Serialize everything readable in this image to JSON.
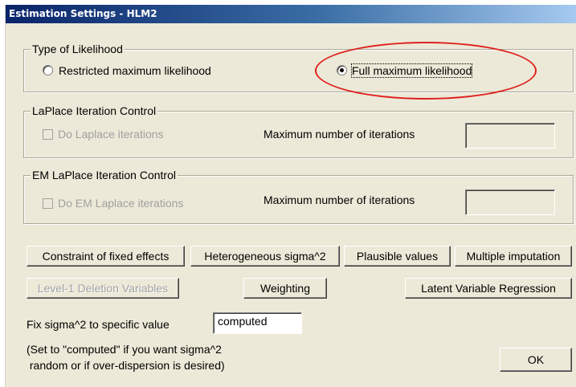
{
  "window": {
    "title": "Estimation Settings - HLM2"
  },
  "likelihood": {
    "title": "Type of Likelihood",
    "option_restricted": "Restricted maximum likelihood",
    "option_full": "Full maximum likelihood",
    "selected": "Full maximum likelihood"
  },
  "laplace": {
    "title": "LaPlace Iteration Control",
    "checkbox_label": "Do Laplace iterations",
    "checked": false,
    "max_label": "Maximum number of  iterations",
    "max_value": ""
  },
  "em_laplace": {
    "title": "EM LaPlace Iteration Control",
    "checkbox_label": "Do  EM Laplace iterations",
    "checked": false,
    "max_label": "Maximum number of iterations",
    "max_value": ""
  },
  "buttons": {
    "constraint": "Constraint of fixed effects",
    "hetero": "Heterogeneous sigma^2",
    "plausible": "Plausible values",
    "multiple": "Multiple imputation",
    "deletion": "Level-1 Deletion Variables",
    "weighting": "Weighting",
    "latent": "Latent Variable Regression",
    "ok": "OK"
  },
  "sigma": {
    "label": "Fix sigma^2 to specific value",
    "value": "computed",
    "note_line1": "(Set to \"computed\" if you want sigma^2",
    "note_line2": " random or if over-dispersion is desired)"
  },
  "colors": {
    "dialog_bg": "#ece9d8",
    "title_start": "#0a246a",
    "title_end": "#a6caf0",
    "annotation": "#e0201c"
  }
}
